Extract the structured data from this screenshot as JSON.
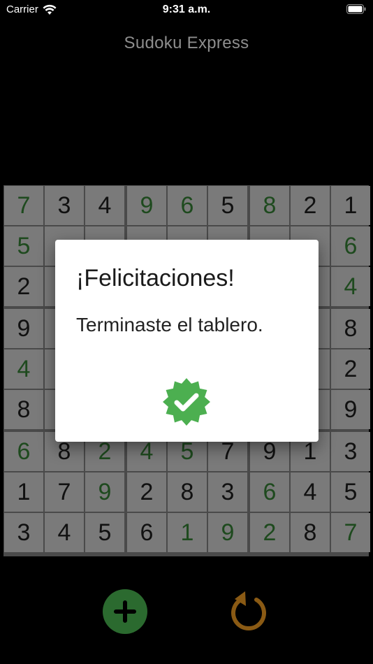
{
  "status_bar": {
    "carrier": "Carrier",
    "time": "9:31 a.m."
  },
  "app": {
    "title": "Sudoku Express"
  },
  "board": {
    "rows": [
      [
        "7",
        "3",
        "4",
        "9",
        "6",
        "5",
        "8",
        "2",
        "1"
      ],
      [
        "5",
        "",
        "",
        "",
        "",
        "",
        "",
        "",
        "6"
      ],
      [
        "2",
        "",
        "",
        "",
        "",
        "",
        "",
        "",
        "4"
      ],
      [
        "9",
        "",
        "",
        "",
        "",
        "",
        "",
        "",
        "8"
      ],
      [
        "4",
        "",
        "",
        "",
        "",
        "",
        "",
        "",
        "2"
      ],
      [
        "8",
        "",
        "",
        "",
        "",
        "",
        "",
        "",
        "9"
      ],
      [
        "6",
        "8",
        "2",
        "4",
        "5",
        "7",
        "9",
        "1",
        "3"
      ],
      [
        "1",
        "7",
        "9",
        "2",
        "8",
        "3",
        "6",
        "4",
        "5"
      ],
      [
        "3",
        "4",
        "5",
        "6",
        "1",
        "9",
        "2",
        "8",
        "7"
      ]
    ],
    "user_entered": [
      [
        1,
        0,
        0,
        1,
        1,
        0,
        1,
        0,
        0
      ],
      [
        1,
        0,
        0,
        0,
        0,
        0,
        0,
        0,
        1
      ],
      [
        0,
        0,
        0,
        0,
        0,
        0,
        0,
        0,
        1
      ],
      [
        0,
        0,
        0,
        0,
        0,
        0,
        0,
        0,
        0
      ],
      [
        1,
        0,
        0,
        0,
        0,
        0,
        0,
        0,
        0
      ],
      [
        0,
        0,
        0,
        0,
        0,
        0,
        0,
        0,
        0
      ],
      [
        1,
        0,
        1,
        1,
        1,
        0,
        0,
        0,
        0
      ],
      [
        0,
        0,
        1,
        0,
        0,
        0,
        1,
        0,
        0
      ],
      [
        0,
        0,
        0,
        0,
        1,
        1,
        1,
        0,
        1
      ]
    ],
    "colors": {
      "cell": "#7a7a7a",
      "grid": "#4a4a4a",
      "given_digit": "#111111",
      "user_digit": "#1e4a1e"
    }
  },
  "dialog": {
    "title": "¡Felicitaciones!",
    "message": "Terminaste el tablero.",
    "icon": "verified-badge-icon",
    "icon_color": "#4caf50"
  },
  "controls": {
    "new_game_icon": "plus-icon",
    "new_game_color": "#2b6a2f",
    "reset_icon": "refresh-icon",
    "reset_color": "#8a5a14"
  }
}
